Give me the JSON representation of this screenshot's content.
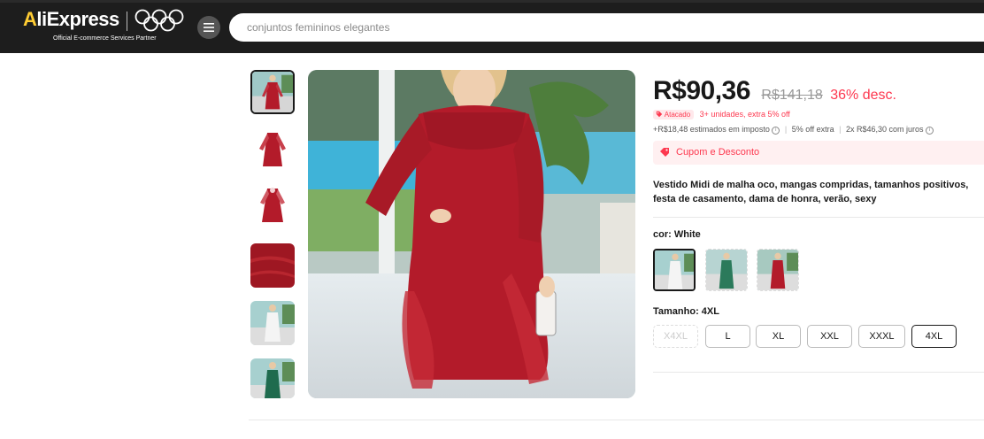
{
  "header": {
    "logo": "AliExpress",
    "partner": "Official E-commerce Services Partner",
    "search_placeholder": "conjuntos femininos elegantes"
  },
  "gallery": {
    "thumbnails": [
      {
        "color": "#b31b2a"
      },
      {
        "color": "#b31b2a"
      },
      {
        "color": "#b31b2a"
      },
      {
        "color": "#9e1722"
      },
      {
        "color": "#f0f0f0"
      },
      {
        "color": "#1f6b4e"
      }
    ]
  },
  "product": {
    "price": "R$90,36",
    "old_price": "R$141,18",
    "discount": "36% desc.",
    "badge": "Atacado",
    "wholesale": "3+ unidades, extra 5% off",
    "tax": "+R$18,48 estimados em imposto",
    "extra": "5% off extra",
    "installments": "2x R$46,30 com juros",
    "coupon": "Cupom e Desconto",
    "title": "Vestido Midi de malha oco, mangas compridas, tamanhos positivos, festa de casamento, dama de honra, verão, sexy",
    "color_label": "cor: White",
    "size_label": "Tamanho: 4XL",
    "sizes": [
      "X4XL",
      "L",
      "XL",
      "XXL",
      "XXXL",
      "4XL"
    ]
  },
  "colors": {
    "accent": "#fd384f",
    "header_bg": "#1d1d1d",
    "dress_red": "#b31b2a",
    "dress_green": "#2b7a5b"
  }
}
